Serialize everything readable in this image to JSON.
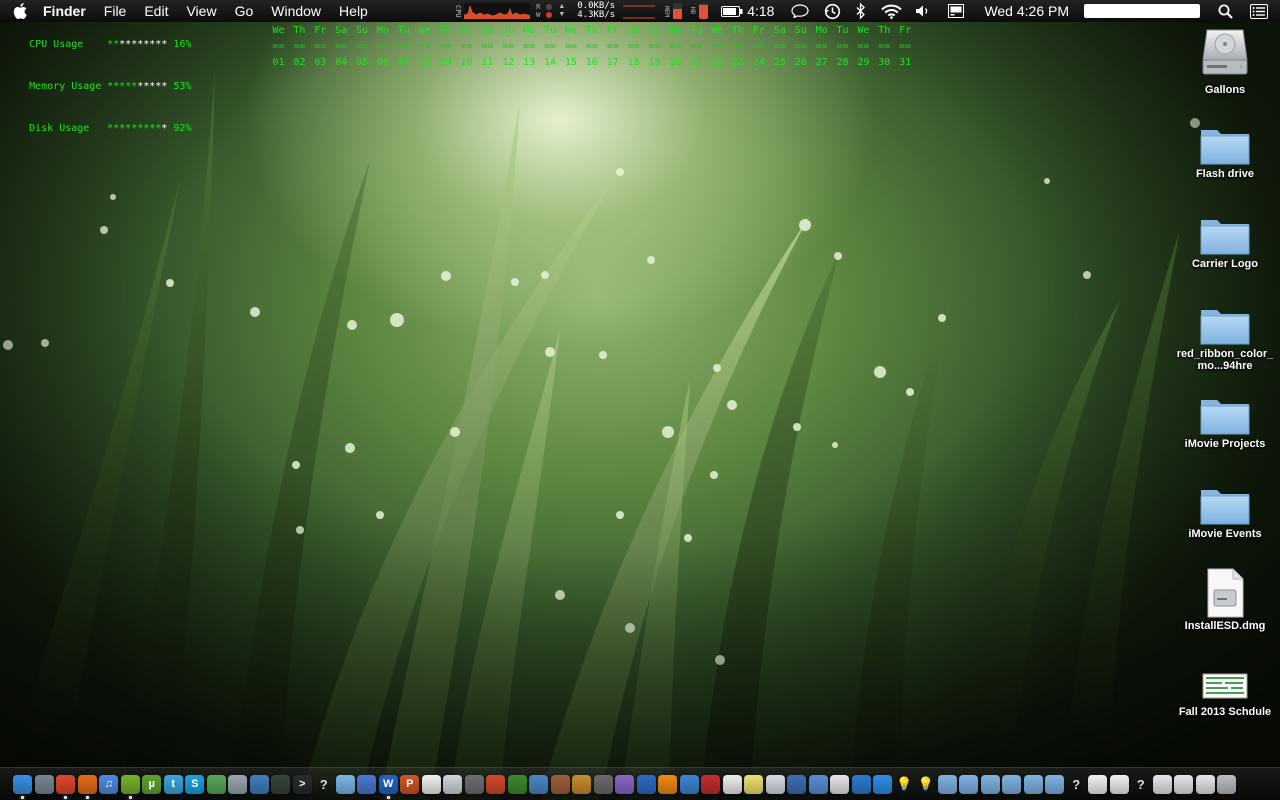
{
  "menubar": {
    "app_name": "Finder",
    "menus": [
      "File",
      "Edit",
      "View",
      "Go",
      "Window",
      "Help"
    ],
    "cpu_label": "CPU",
    "disk_label_top": "R",
    "disk_label_bottom": "W",
    "net_down": "0.0KB/s",
    "net_up": "4.3KB/s",
    "mem_label": "MEM",
    "hd_label": "HD",
    "battery_time": "4:18",
    "clock": "Wed 4:26 PM",
    "spotlight_value": ""
  },
  "geektool": {
    "stats": [
      {
        "label": "CPU Usage",
        "bar_on": "**",
        "bar_off": "********",
        "pct": " 16%"
      },
      {
        "label": "Memory Usage",
        "bar_on": "*****",
        "bar_off": "*****",
        "pct": " 53%"
      },
      {
        "label": "Disk Usage",
        "bar_on": "*********",
        "bar_off": "*",
        "pct": " 92%"
      }
    ],
    "calendar": {
      "days": [
        "We",
        "Th",
        "Fr",
        "Sa",
        "Su",
        "Mo",
        "Tu",
        "We",
        "Th",
        "Fr",
        "Sa",
        "Su",
        "Mo",
        "Tu",
        "We",
        "Th",
        "Fr",
        "Sa",
        "Su",
        "Mo",
        "Tu",
        "We",
        "Th",
        "Fr",
        "Sa",
        "Su",
        "Mo",
        "Tu",
        "We",
        "Th",
        "Fr"
      ],
      "sep": "==",
      "dates": [
        "01",
        "02",
        "03",
        "04",
        "05",
        "06",
        "07",
        "08",
        "09",
        "10",
        "11",
        "12",
        "13",
        "14",
        "15",
        "16",
        "17",
        "18",
        "19",
        "20",
        "21",
        "22",
        "23",
        "24",
        "25",
        "26",
        "27",
        "28",
        "29",
        "30",
        "31"
      ]
    }
  },
  "desktop_icons": [
    {
      "label": "Gallons",
      "icon": "hard-drive-icon"
    },
    {
      "label": "Flash drive",
      "icon": "folder-icon"
    },
    {
      "label": "Carrier Logo",
      "icon": "folder-icon"
    },
    {
      "label": "red_ribbon_color_mo...94hre",
      "icon": "folder-icon"
    },
    {
      "label": "iMovie Projects",
      "icon": "folder-icon"
    },
    {
      "label": "iMovie Events",
      "icon": "folder-icon"
    },
    {
      "label": "InstallESD.dmg",
      "icon": "disk-image-icon"
    },
    {
      "label": "Fall 2013 Schdule",
      "icon": "spreadsheet-icon"
    }
  ],
  "dock": {
    "items": [
      {
        "name": "finder-icon",
        "color": "#3b8fe6",
        "glyph": "",
        "running": true
      },
      {
        "name": "launchpad-icon",
        "color": "#7a8793",
        "glyph": "",
        "running": false
      },
      {
        "name": "chrome-icon",
        "color": "#e0482c",
        "glyph": "",
        "running": true
      },
      {
        "name": "firefox-icon",
        "color": "#e86c1c",
        "glyph": "",
        "running": true
      },
      {
        "name": "itunes-icon",
        "color": "#4c8ee0",
        "glyph": "♫",
        "running": false
      },
      {
        "name": "spotify-icon",
        "color": "#75b32c",
        "glyph": "",
        "running": true
      },
      {
        "name": "utorrent-icon",
        "color": "#5ca532",
        "glyph": "µ",
        "running": false
      },
      {
        "name": "twitter-icon",
        "color": "#3aa6e0",
        "glyph": "t",
        "running": false
      },
      {
        "name": "skype-icon",
        "color": "#1ba2e6",
        "glyph": "S",
        "running": false
      },
      {
        "name": "network-icon",
        "color": "#5aa85a",
        "glyph": "",
        "running": false
      },
      {
        "name": "utility-icon",
        "color": "#9aa6b0",
        "glyph": "",
        "running": false
      },
      {
        "name": "network-utility-icon",
        "color": "#3f7fbf",
        "glyph": "",
        "running": false
      },
      {
        "name": "activity-monitor-icon",
        "color": "#39443a",
        "glyph": "",
        "running": false
      },
      {
        "name": "terminal-icon",
        "color": "#2b2b2b",
        "glyph": ">",
        "running": false
      },
      {
        "name": "unknown-app-icon",
        "color": "transparent",
        "glyph": "?",
        "running": false
      },
      {
        "name": "cube-app-icon",
        "color": "#7ab7e8",
        "glyph": "",
        "running": false
      },
      {
        "name": "text-editor-icon",
        "color": "#4a7ad0",
        "glyph": "",
        "running": false
      },
      {
        "name": "word-icon",
        "color": "#1f65c8",
        "glyph": "W",
        "running": true
      },
      {
        "name": "powerpoint-icon",
        "color": "#d2551f",
        "glyph": "P",
        "running": false
      },
      {
        "name": "calendar-icon",
        "color": "#f1f1f1",
        "glyph": "",
        "running": false
      },
      {
        "name": "preview-icon",
        "color": "#cfd6de",
        "glyph": "",
        "running": false
      },
      {
        "name": "dashboard-icon",
        "color": "#6d6f73",
        "glyph": "",
        "running": false
      },
      {
        "name": "record-app-icon",
        "color": "#d34a2c",
        "glyph": "",
        "running": false
      },
      {
        "name": "battery-app-icon",
        "color": "#3e8a2f",
        "glyph": "",
        "running": false
      },
      {
        "name": "quicktime-icon",
        "color": "#4b86c6",
        "glyph": "",
        "running": false
      },
      {
        "name": "pot-app-icon",
        "color": "#a0603a",
        "glyph": "",
        "running": false
      },
      {
        "name": "photo-app-icon",
        "color": "#c98d2e",
        "glyph": "",
        "running": false
      },
      {
        "name": "movie-app-icon",
        "color": "#6b6b6b",
        "glyph": "",
        "running": false
      },
      {
        "name": "imovie-icon",
        "color": "#8a66c8",
        "glyph": "",
        "running": false
      },
      {
        "name": "dvd-player-icon",
        "color": "#2d6cc4",
        "glyph": "",
        "running": false
      },
      {
        "name": "vlc-icon",
        "color": "#f08a14",
        "glyph": "",
        "running": false
      },
      {
        "name": "safari-icon",
        "color": "#3e86d6",
        "glyph": "",
        "running": false
      },
      {
        "name": "photo-booth-icon",
        "color": "#c52e2e",
        "glyph": "",
        "running": false
      },
      {
        "name": "textedit-icon",
        "color": "#eeeeee",
        "glyph": "",
        "running": false
      },
      {
        "name": "stickies-icon",
        "color": "#f0e070",
        "glyph": "",
        "running": false
      },
      {
        "name": "mail-icon",
        "color": "#d7dce3",
        "glyph": "",
        "running": false
      },
      {
        "name": "screen-app-icon",
        "color": "#3d6fb8",
        "glyph": "",
        "running": false
      },
      {
        "name": "folder-app-icon",
        "color": "#5a8fd6",
        "glyph": "",
        "running": false
      },
      {
        "name": "spreadsheet-app-icon",
        "color": "#e7e7e7",
        "glyph": "",
        "running": false
      },
      {
        "name": "dropbox-icon",
        "color": "#2b7bd1",
        "glyph": "",
        "running": false
      },
      {
        "name": "app-store-icon",
        "color": "#2e8ee6",
        "glyph": "",
        "running": false
      },
      {
        "name": "light-bulb-icon",
        "color": "transparent",
        "glyph": "💡",
        "running": false
      },
      {
        "name": "light-bulb-2-icon",
        "color": "transparent",
        "glyph": "💡",
        "running": false
      },
      {
        "name": "folder-icon",
        "color": "#7fb3e2",
        "glyph": "",
        "running": false
      },
      {
        "name": "folder-2-icon",
        "color": "#7fb3e2",
        "glyph": "",
        "running": false
      },
      {
        "name": "folder-3-icon",
        "color": "#7fb3e2",
        "glyph": "",
        "running": false
      },
      {
        "name": "folder-4-icon",
        "color": "#7fb3e2",
        "glyph": "",
        "running": false
      },
      {
        "name": "folder-5-icon",
        "color": "#7fb3e2",
        "glyph": "",
        "running": false
      },
      {
        "name": "applications-folder-icon",
        "color": "#7fb3e2",
        "glyph": "",
        "running": false
      },
      {
        "name": "unknown-folder-icon",
        "color": "transparent",
        "glyph": "?",
        "running": false
      },
      {
        "name": "document-icon",
        "color": "#f1f1f1",
        "glyph": "",
        "running": false
      },
      {
        "name": "document-2-icon",
        "color": "#f1f1f1",
        "glyph": "",
        "running": false
      },
      {
        "name": "unknown-doc-icon",
        "color": "transparent",
        "glyph": "?",
        "running": false
      },
      {
        "name": "stack-icon",
        "color": "#e7e7e7",
        "glyph": "",
        "running": false
      },
      {
        "name": "stack-2-icon",
        "color": "#e7e7e7",
        "glyph": "",
        "running": false
      },
      {
        "name": "stack-3-icon",
        "color": "#e7e7e7",
        "glyph": "",
        "running": false
      },
      {
        "name": "trash-icon",
        "color": "#b9bec4",
        "glyph": "",
        "running": false
      }
    ]
  }
}
